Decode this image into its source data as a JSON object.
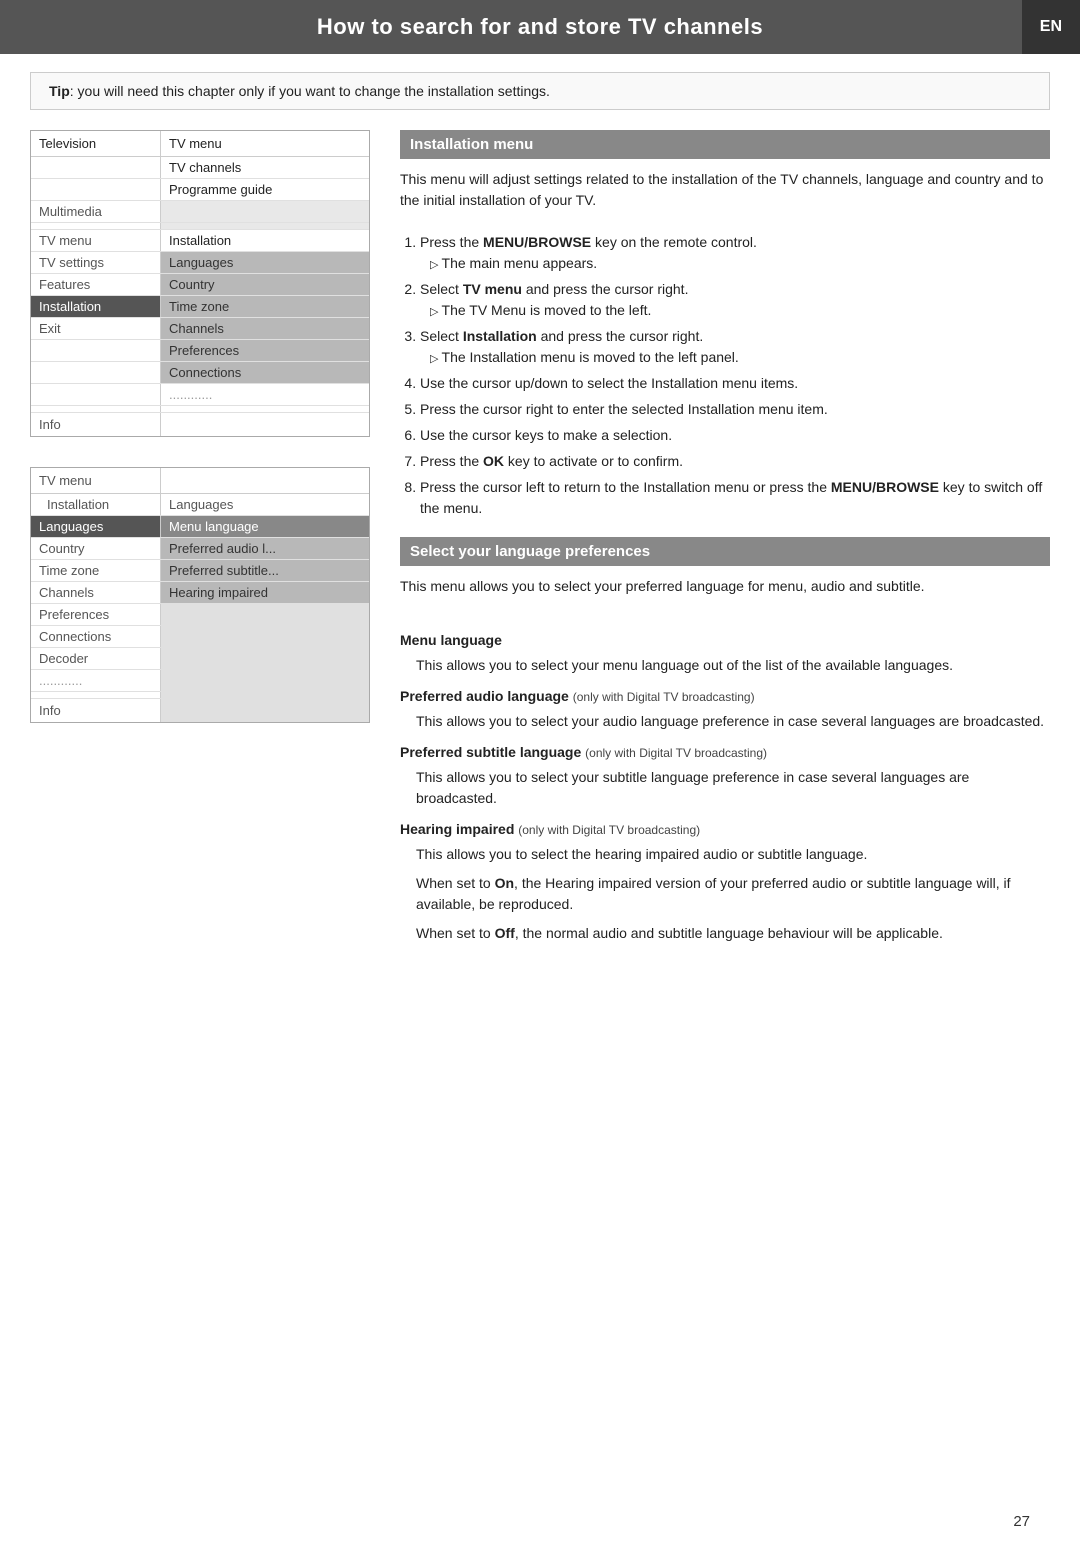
{
  "header": {
    "title": "How to search for and store TV channels",
    "lang_badge": "EN"
  },
  "tip": {
    "label": "Tip",
    "text": ": you will need this chapter only if you want to change the installation settings."
  },
  "menu1": {
    "title_left": "Television",
    "title_right": "TV menu",
    "rows_left": [
      {
        "label": "Television",
        "type": "header"
      },
      {
        "label": "",
        "type": "spacer"
      },
      {
        "label": "",
        "type": "spacer"
      },
      {
        "label": "Multimedia",
        "type": "header"
      },
      {
        "label": "",
        "type": "spacer"
      },
      {
        "label": "TV menu",
        "type": "header"
      },
      {
        "label": "TV settings",
        "type": "item"
      },
      {
        "label": "Features",
        "type": "item"
      },
      {
        "label": "Installation",
        "type": "selected"
      },
      {
        "label": "Exit",
        "type": "item"
      },
      {
        "label": "",
        "type": "spacer"
      },
      {
        "label": "",
        "type": "spacer"
      },
      {
        "label": "",
        "type": "spacer"
      },
      {
        "label": "",
        "type": "spacer"
      },
      {
        "label": "Info",
        "type": "item"
      }
    ],
    "rows_right": [
      {
        "label": "TV menu",
        "type": "plain"
      },
      {
        "label": "TV channels",
        "type": "plain"
      },
      {
        "label": "Programme guide",
        "type": "plain"
      },
      {
        "label": "",
        "type": "spacer"
      },
      {
        "label": "",
        "type": "spacer"
      },
      {
        "label": "Installation",
        "type": "plain"
      },
      {
        "label": "Languages",
        "type": "highlighted"
      },
      {
        "label": "Country",
        "type": "highlighted"
      },
      {
        "label": "Time zone",
        "type": "highlighted"
      },
      {
        "label": "Channels",
        "type": "highlighted"
      },
      {
        "label": "Preferences",
        "type": "highlighted"
      },
      {
        "label": "Connections",
        "type": "highlighted"
      },
      {
        "label": "............",
        "type": "dots"
      },
      {
        "label": "",
        "type": "spacer"
      },
      {
        "label": "",
        "type": "spacer"
      }
    ]
  },
  "section1": {
    "title": "Installation menu",
    "intro": "This menu will adjust settings related to the installation of the TV channels, language and country and to the initial installation of your TV.",
    "steps": [
      {
        "text": "Press the ",
        "bold": "MENU/BROWSE",
        "text2": " key on the remote control.",
        "sub": "The main menu appears."
      },
      {
        "text": "Select ",
        "bold": "TV menu",
        "text2": " and press the cursor right.",
        "sub": "The TV Menu is moved to the left."
      },
      {
        "text": "Select ",
        "bold": "Installation",
        "text2": " and press the cursor right.",
        "sub": "The Installation menu is moved to the left panel."
      },
      {
        "text": "Use the cursor up/down to select the Installation menu items.",
        "bold": "",
        "text2": "",
        "sub": ""
      },
      {
        "text": "Press the cursor right to enter the selected Installation menu item.",
        "bold": "",
        "text2": "",
        "sub": ""
      },
      {
        "text": "Use the cursor keys to make a selection.",
        "bold": "",
        "text2": "",
        "sub": ""
      },
      {
        "text": "Press the ",
        "bold": "OK",
        "text2": " key to activate or to confirm.",
        "sub": ""
      },
      {
        "text": "Press the cursor left to return to the Installation menu or press the ",
        "bold": "MENU/BROWSE",
        "text2": " key to switch off the menu.",
        "sub": ""
      }
    ]
  },
  "menu2": {
    "title_left": "TV menu",
    "rows_left": [
      {
        "label": "TV menu",
        "type": "header"
      },
      {
        "label": "Installation",
        "type": "sub"
      },
      {
        "label": "Languages",
        "type": "selected"
      },
      {
        "label": "Country",
        "type": "item"
      },
      {
        "label": "Time zone",
        "type": "item"
      },
      {
        "label": "Channels",
        "type": "item"
      },
      {
        "label": "Preferences",
        "type": "item"
      },
      {
        "label": "Connections",
        "type": "item"
      },
      {
        "label": "Decoder",
        "type": "item"
      },
      {
        "label": "............",
        "type": "dots"
      },
      {
        "label": "",
        "type": "spacer"
      },
      {
        "label": "Info",
        "type": "item"
      }
    ],
    "rows_right": [
      {
        "label": "Languages",
        "type": "plain"
      },
      {
        "label": "Menu language",
        "type": "selected"
      },
      {
        "label": "Preferred audio l...",
        "type": "highlighted"
      },
      {
        "label": "Preferred subtitle...",
        "type": "highlighted"
      },
      {
        "label": "Hearing impaired",
        "type": "highlighted"
      },
      {
        "label": "",
        "type": "empty"
      },
      {
        "label": "",
        "type": "empty"
      },
      {
        "label": "",
        "type": "empty"
      },
      {
        "label": "",
        "type": "empty"
      },
      {
        "label": "",
        "type": "empty"
      },
      {
        "label": "",
        "type": "empty"
      },
      {
        "label": "",
        "type": "empty"
      }
    ]
  },
  "section2": {
    "title": "Select your language preferences",
    "intro": "This menu allows you to select your preferred language for menu, audio and subtitle.",
    "menu_language_title": "Menu language",
    "menu_language_body": "This allows you to select your menu language out of the list of the available languages.",
    "pref_audio_title": "Preferred audio language",
    "pref_audio_qualifier": "(only with Digital TV broadcasting)",
    "pref_audio_body": "This allows you to select your audio language preference in case several languages are broadcasted.",
    "pref_subtitle_title": "Preferred subtitle language",
    "pref_subtitle_qualifier": "(only with Digital TV broadcasting)",
    "pref_subtitle_body": "This allows you to select your subtitle language preference in case several languages are broadcasted.",
    "hearing_title": "Hearing impaired",
    "hearing_qualifier": "(only with Digital TV broadcasting)",
    "hearing_body1": "This allows you to select the hearing impaired audio or subtitle language.",
    "hearing_body2": "When set to ",
    "hearing_body2_bold": "On",
    "hearing_body2_rest": ", the Hearing impaired version of your preferred audio or subtitle language will, if available, be reproduced.",
    "hearing_body3": "When set to ",
    "hearing_body3_bold": "Off",
    "hearing_body3_rest": ", the normal audio and subtitle language behaviour will be applicable."
  },
  "page_number": "27"
}
